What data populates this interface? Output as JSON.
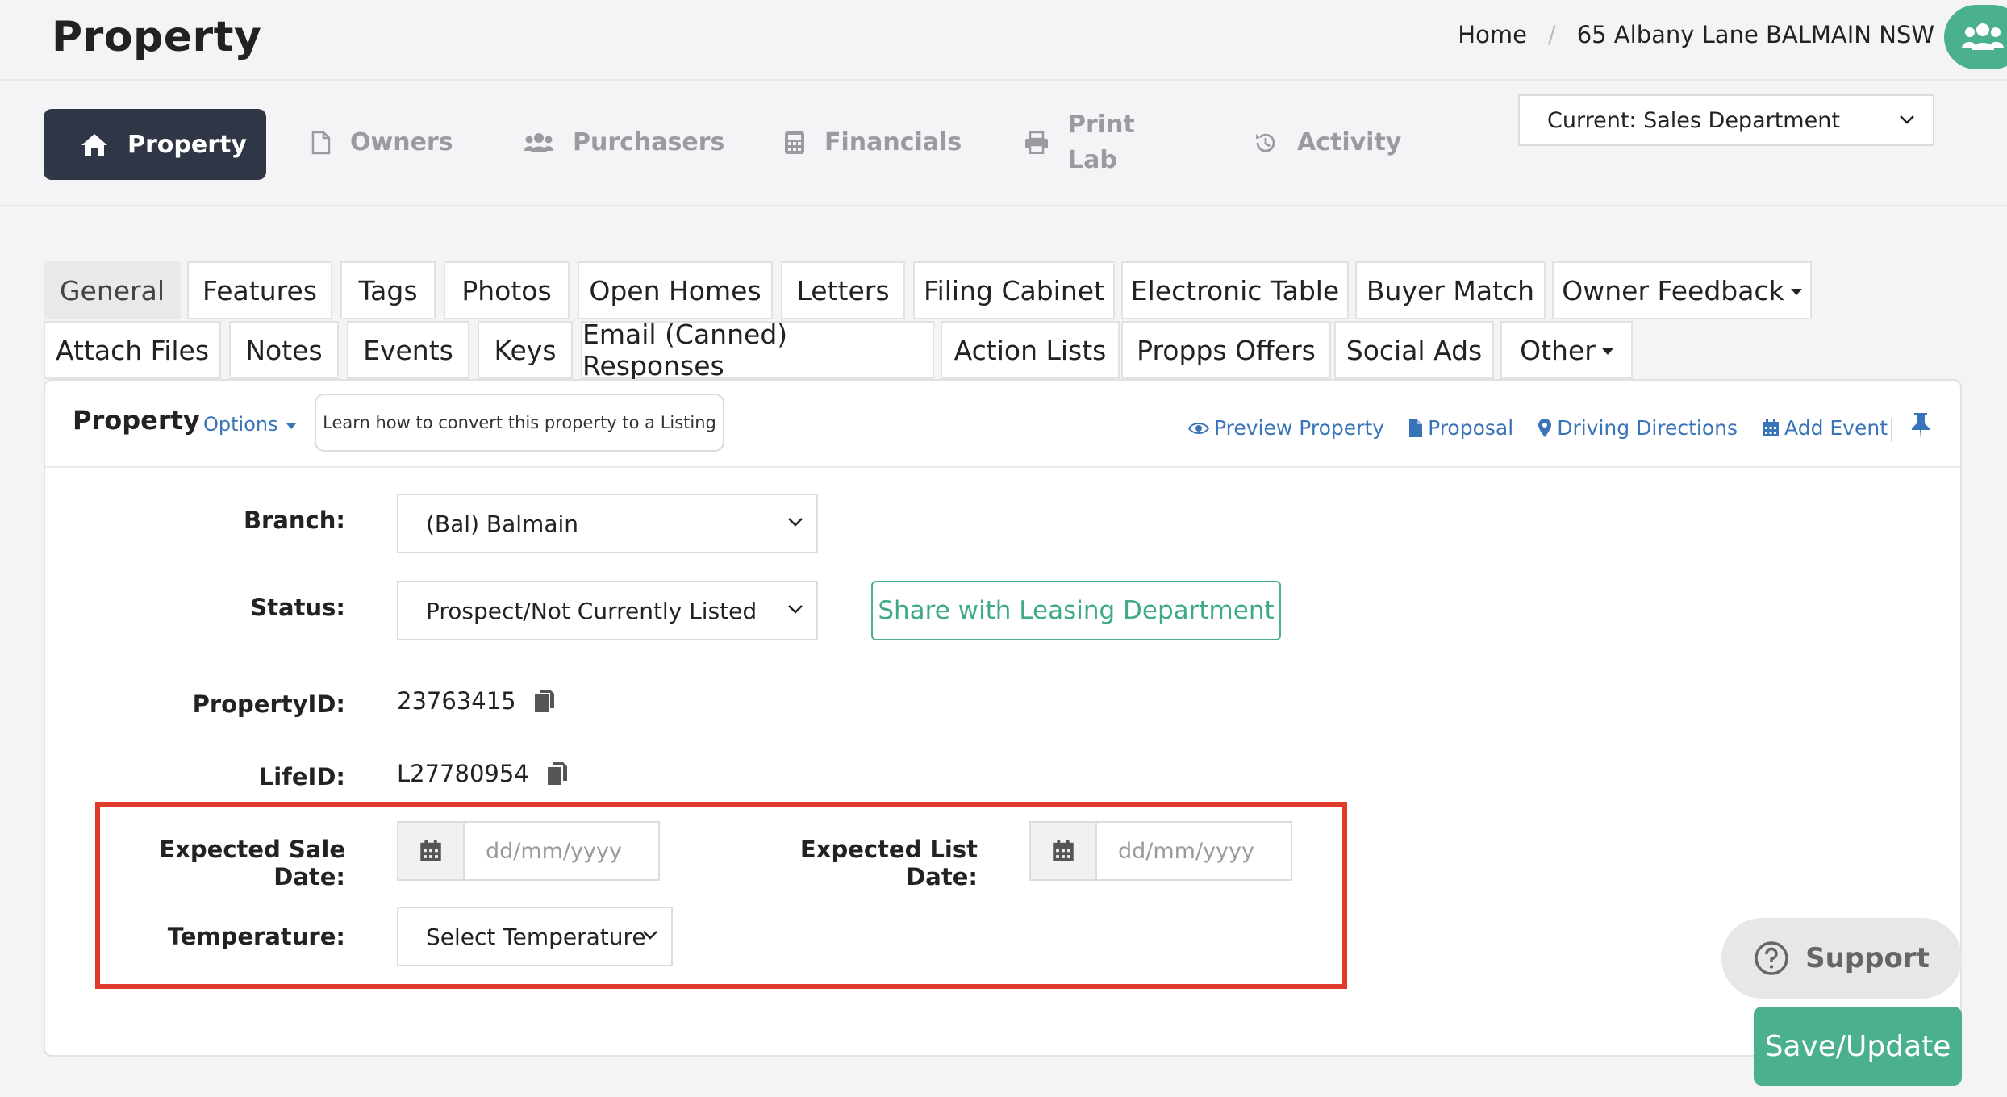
{
  "header": {
    "title": "Property",
    "breadcrumb": {
      "home": "Home",
      "separator": "/",
      "current": "65 Albany Lane BALMAIN NSW"
    }
  },
  "nav": {
    "items": [
      {
        "label": "Property",
        "icon": "home-icon",
        "active": true
      },
      {
        "label": "Owners",
        "icon": "file-icon"
      },
      {
        "label": "Purchasers",
        "icon": "users-icon"
      },
      {
        "label": "Financials",
        "icon": "calculator-icon"
      },
      {
        "label": "Print Lab",
        "line1": "Print",
        "line2": "Lab",
        "icon": "printer-icon"
      },
      {
        "label": "Activity",
        "icon": "history-icon"
      }
    ],
    "department": "Current: Sales Department"
  },
  "tabs": {
    "row1": [
      "General",
      "Features",
      "Tags",
      "Photos",
      "Open Homes",
      "Letters",
      "Filing Cabinet",
      "Electronic Table",
      "Buyer Match",
      "Owner Feedback"
    ],
    "row2": [
      "Attach Files",
      "Notes",
      "Events",
      "Keys",
      "Email (Canned) Responses",
      "Action Lists",
      "Propps Offers",
      "Social Ads",
      "Other"
    ],
    "active": "General"
  },
  "panel": {
    "title": "Property",
    "options_label": "Options",
    "learn_label": "Learn how to convert this property to a Listing",
    "links": {
      "preview": "Preview Property",
      "proposal": "Proposal",
      "directions": "Driving Directions",
      "add_event": "Add Event"
    }
  },
  "form": {
    "branch_label": "Branch:",
    "branch_value": "(Bal) Balmain",
    "status_label": "Status:",
    "status_value": "Prospect/Not Currently Listed",
    "share_label": "Share with Leasing Department",
    "property_id_label": "PropertyID:",
    "property_id": "23763415",
    "life_id_label": "LifeID:",
    "life_id": "L27780954",
    "expected_sale_label": "Expected Sale Date:",
    "expected_list_label": "Expected List Date:",
    "date_placeholder": "dd/mm/yyyy",
    "temperature_label": "Temperature:",
    "temperature_value": "Select Temperature"
  },
  "buttons": {
    "support": "Support",
    "save": "Save/Update"
  },
  "colors": {
    "accent": "#4ab090",
    "nav_active": "#2f3747",
    "link": "#3a74b8",
    "highlight": "#e03a2a"
  }
}
